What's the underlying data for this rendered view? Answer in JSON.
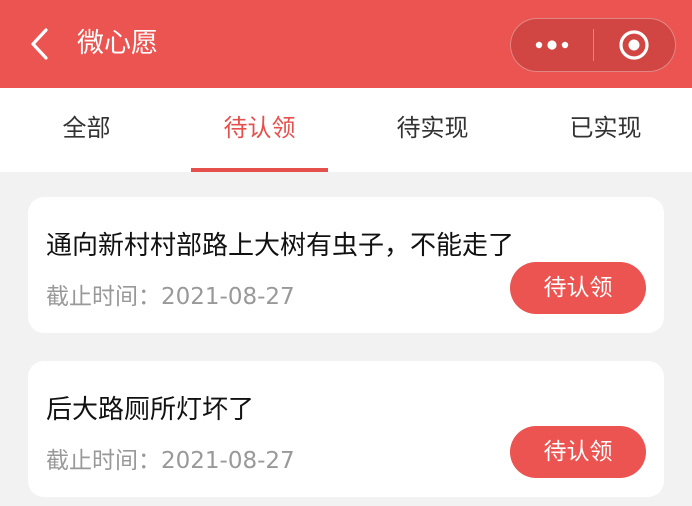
{
  "header": {
    "title": "微心愿",
    "back_icon": "chevron-left-icon",
    "more_icon": "more-dots-icon",
    "close_icon": "target-circle-icon",
    "background_color": "#eb5450"
  },
  "tabs": [
    {
      "label": "全部",
      "active": false
    },
    {
      "label": "待认领",
      "active": true
    },
    {
      "label": "待实现",
      "active": false
    },
    {
      "label": "已实现",
      "active": false
    }
  ],
  "accent_color": "#e5504c",
  "wishes": [
    {
      "title": "通向新村村部路上大树有虫子，不能走了",
      "deadline_label": "截止时间：",
      "deadline": "2021-08-27",
      "button_label": "待认领"
    },
    {
      "title": "后大路厕所灯坏了",
      "deadline_label": "截止时间：",
      "deadline": "2021-08-27",
      "button_label": "待认领"
    }
  ]
}
